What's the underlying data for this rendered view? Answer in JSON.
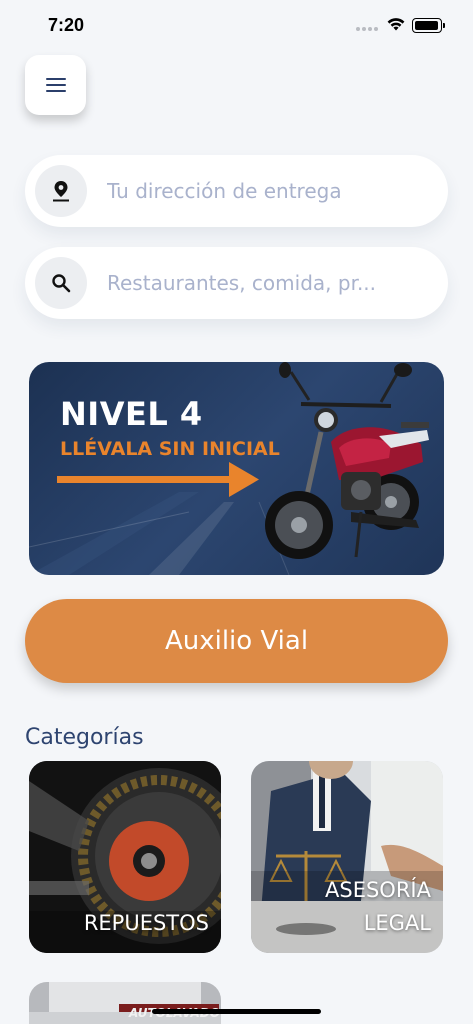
{
  "status_bar": {
    "time": "7:20"
  },
  "address": {
    "placeholder": "Tu dirección de entrega"
  },
  "search": {
    "placeholder": "Restaurantes, comida, pr..."
  },
  "banner": {
    "title": "NIVEL 4",
    "subtitle": "LLÉVALA SIN INICIAL"
  },
  "auxilio": {
    "label": "Auxilio Vial"
  },
  "categories": {
    "title": "Categorías",
    "items": [
      {
        "label": "REPUESTOS"
      },
      {
        "label_line1": "ASESORÍA",
        "label_line2": "LEGAL"
      },
      {
        "label": "AUTOLAVADO"
      }
    ]
  },
  "colors": {
    "accent": "#dd8a45",
    "navy": "#2e4470",
    "background": "#f4f6f9"
  },
  "icons": [
    "menu-icon",
    "location-pin-icon",
    "search-icon",
    "wifi-icon",
    "battery-icon"
  ]
}
